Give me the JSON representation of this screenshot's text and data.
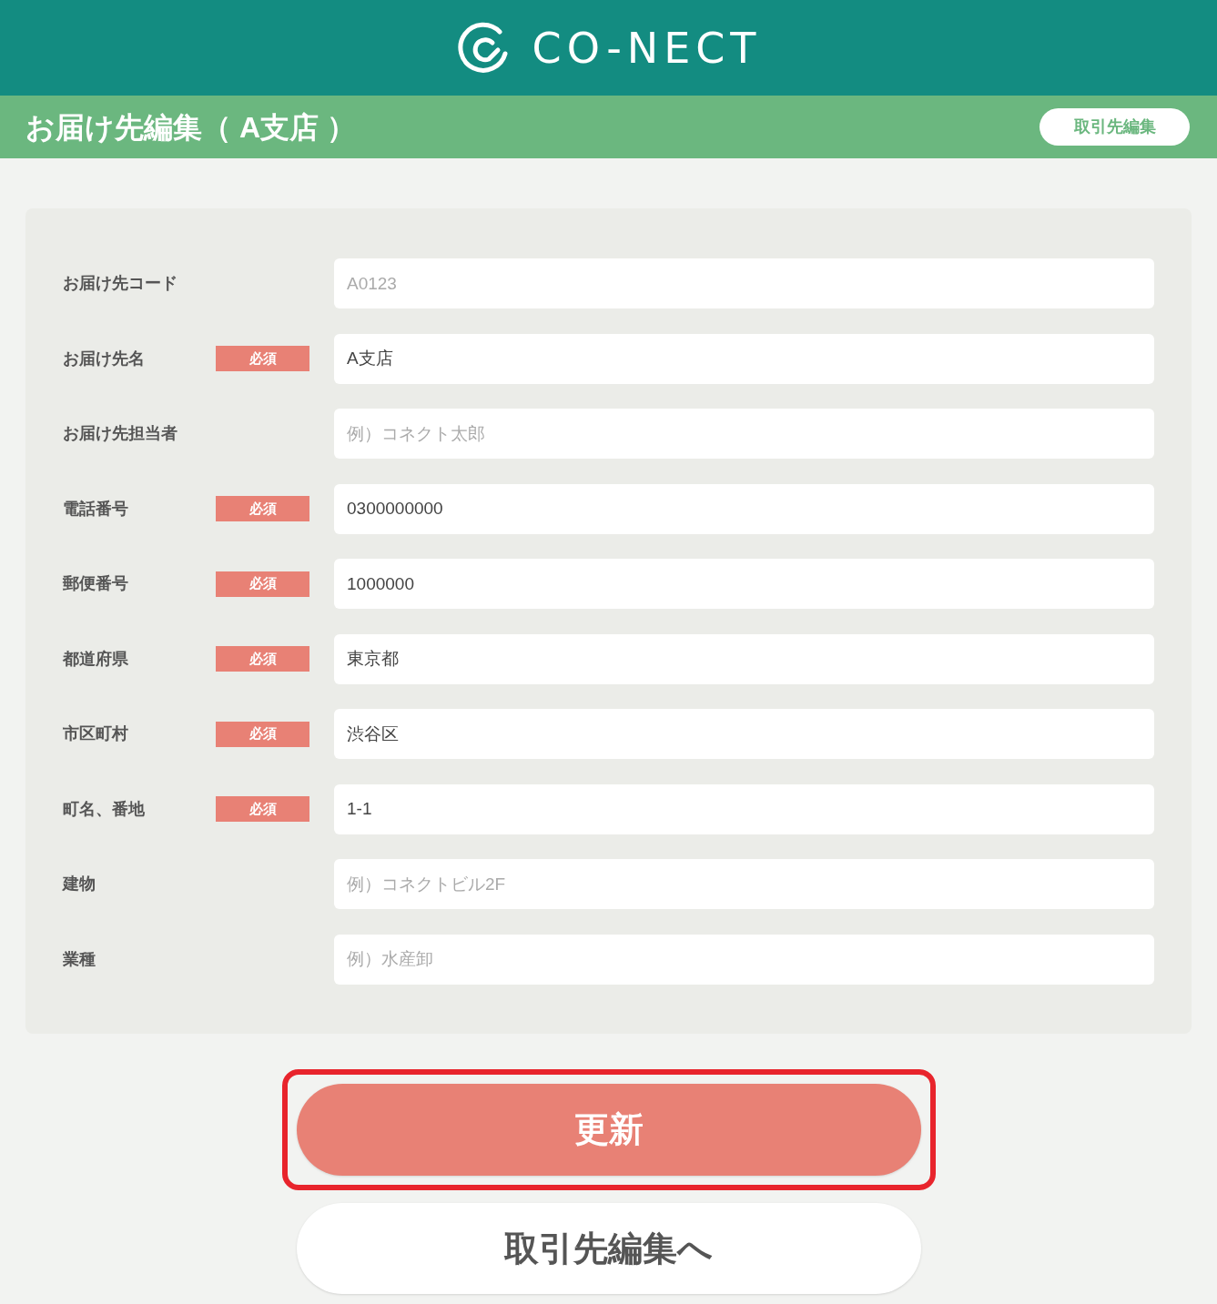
{
  "header": {
    "logo_text": "CO-NECT"
  },
  "title_bar": {
    "title": "お届け先編集（ A支店 ）",
    "button": "取引先編集"
  },
  "fields": [
    {
      "label": "お届け先コード",
      "required": false,
      "placeholder": "A0123"
    },
    {
      "label": "お届け先名",
      "required": true,
      "badge": "必須",
      "value": "A支店"
    },
    {
      "label": "お届け先担当者",
      "required": false,
      "placeholder": "例）コネクト太郎"
    },
    {
      "label": "電話番号",
      "required": true,
      "badge": "必須",
      "value": "0300000000"
    },
    {
      "label": "郵便番号",
      "required": true,
      "badge": "必須",
      "value": "1000000"
    },
    {
      "label": "都道府県",
      "required": true,
      "badge": "必須",
      "value": "東京都"
    },
    {
      "label": "市区町村",
      "required": true,
      "badge": "必須",
      "value": "渋谷区"
    },
    {
      "label": "町名、番地",
      "required": true,
      "badge": "必須",
      "value": "1-1"
    },
    {
      "label": "建物",
      "required": false,
      "placeholder": "例）コネクトビル2F"
    },
    {
      "label": "業種",
      "required": false,
      "placeholder": "例）水産卸"
    }
  ],
  "actions": [
    {
      "label": "更新",
      "kind": "primary",
      "highlighted": true
    },
    {
      "label": "取引先編集へ",
      "kind": "secondary",
      "highlighted": false
    }
  ]
}
